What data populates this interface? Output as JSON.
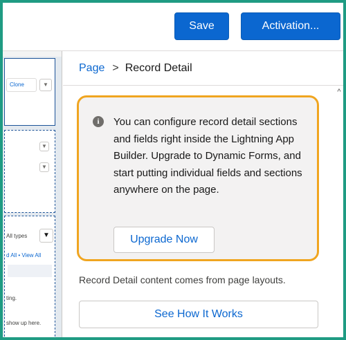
{
  "toolbar": {
    "save_label": "Save",
    "activation_label": "Activation..."
  },
  "canvas_preview": {
    "clone_label": "Clone",
    "all_types_label": "All types",
    "links_label": "d All • View All",
    "partial_text_1": "ting.",
    "partial_text_2": "show up here."
  },
  "breadcrumb": {
    "parent": "Page",
    "separator": ">",
    "current": "Record Detail"
  },
  "info_box": {
    "icon": "info-icon",
    "message": "You can configure record detail sections and fields right inside the Lightning App Builder. Upgrade to Dynamic Forms, and start putting individual fields and sections anywhere on the page.",
    "upgrade_label": "Upgrade Now",
    "highlight_color": "#f0a520"
  },
  "content_note": "Record Detail content comes from page layouts.",
  "see_how_label": "See How It Works",
  "colors": {
    "brand": "#0b67d0",
    "frame_border": "#1f9b83"
  }
}
